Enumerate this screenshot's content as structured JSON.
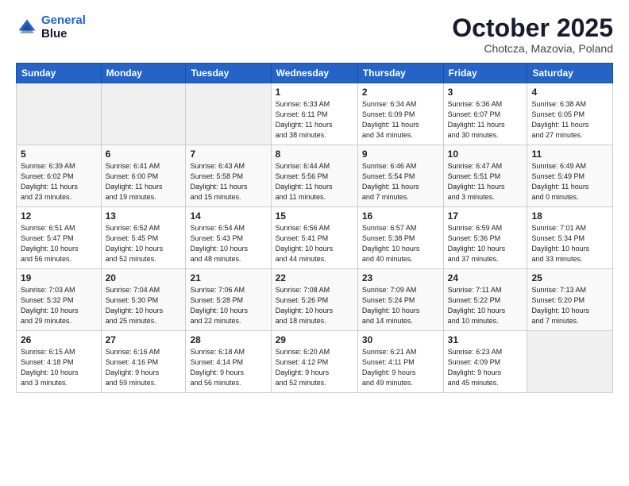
{
  "header": {
    "logo_line1": "General",
    "logo_line2": "Blue",
    "month": "October 2025",
    "location": "Chotcza, Mazovia, Poland"
  },
  "weekdays": [
    "Sunday",
    "Monday",
    "Tuesday",
    "Wednesday",
    "Thursday",
    "Friday",
    "Saturday"
  ],
  "weeks": [
    [
      {
        "day": "",
        "info": ""
      },
      {
        "day": "",
        "info": ""
      },
      {
        "day": "",
        "info": ""
      },
      {
        "day": "1",
        "info": "Sunrise: 6:33 AM\nSunset: 6:11 PM\nDaylight: 11 hours\nand 38 minutes."
      },
      {
        "day": "2",
        "info": "Sunrise: 6:34 AM\nSunset: 6:09 PM\nDaylight: 11 hours\nand 34 minutes."
      },
      {
        "day": "3",
        "info": "Sunrise: 6:36 AM\nSunset: 6:07 PM\nDaylight: 11 hours\nand 30 minutes."
      },
      {
        "day": "4",
        "info": "Sunrise: 6:38 AM\nSunset: 6:05 PM\nDaylight: 11 hours\nand 27 minutes."
      }
    ],
    [
      {
        "day": "5",
        "info": "Sunrise: 6:39 AM\nSunset: 6:02 PM\nDaylight: 11 hours\nand 23 minutes."
      },
      {
        "day": "6",
        "info": "Sunrise: 6:41 AM\nSunset: 6:00 PM\nDaylight: 11 hours\nand 19 minutes."
      },
      {
        "day": "7",
        "info": "Sunrise: 6:43 AM\nSunset: 5:58 PM\nDaylight: 11 hours\nand 15 minutes."
      },
      {
        "day": "8",
        "info": "Sunrise: 6:44 AM\nSunset: 5:56 PM\nDaylight: 11 hours\nand 11 minutes."
      },
      {
        "day": "9",
        "info": "Sunrise: 6:46 AM\nSunset: 5:54 PM\nDaylight: 11 hours\nand 7 minutes."
      },
      {
        "day": "10",
        "info": "Sunrise: 6:47 AM\nSunset: 5:51 PM\nDaylight: 11 hours\nand 3 minutes."
      },
      {
        "day": "11",
        "info": "Sunrise: 6:49 AM\nSunset: 5:49 PM\nDaylight: 11 hours\nand 0 minutes."
      }
    ],
    [
      {
        "day": "12",
        "info": "Sunrise: 6:51 AM\nSunset: 5:47 PM\nDaylight: 10 hours\nand 56 minutes."
      },
      {
        "day": "13",
        "info": "Sunrise: 6:52 AM\nSunset: 5:45 PM\nDaylight: 10 hours\nand 52 minutes."
      },
      {
        "day": "14",
        "info": "Sunrise: 6:54 AM\nSunset: 5:43 PM\nDaylight: 10 hours\nand 48 minutes."
      },
      {
        "day": "15",
        "info": "Sunrise: 6:56 AM\nSunset: 5:41 PM\nDaylight: 10 hours\nand 44 minutes."
      },
      {
        "day": "16",
        "info": "Sunrise: 6:57 AM\nSunset: 5:38 PM\nDaylight: 10 hours\nand 40 minutes."
      },
      {
        "day": "17",
        "info": "Sunrise: 6:59 AM\nSunset: 5:36 PM\nDaylight: 10 hours\nand 37 minutes."
      },
      {
        "day": "18",
        "info": "Sunrise: 7:01 AM\nSunset: 5:34 PM\nDaylight: 10 hours\nand 33 minutes."
      }
    ],
    [
      {
        "day": "19",
        "info": "Sunrise: 7:03 AM\nSunset: 5:32 PM\nDaylight: 10 hours\nand 29 minutes."
      },
      {
        "day": "20",
        "info": "Sunrise: 7:04 AM\nSunset: 5:30 PM\nDaylight: 10 hours\nand 25 minutes."
      },
      {
        "day": "21",
        "info": "Sunrise: 7:06 AM\nSunset: 5:28 PM\nDaylight: 10 hours\nand 22 minutes."
      },
      {
        "day": "22",
        "info": "Sunrise: 7:08 AM\nSunset: 5:26 PM\nDaylight: 10 hours\nand 18 minutes."
      },
      {
        "day": "23",
        "info": "Sunrise: 7:09 AM\nSunset: 5:24 PM\nDaylight: 10 hours\nand 14 minutes."
      },
      {
        "day": "24",
        "info": "Sunrise: 7:11 AM\nSunset: 5:22 PM\nDaylight: 10 hours\nand 10 minutes."
      },
      {
        "day": "25",
        "info": "Sunrise: 7:13 AM\nSunset: 5:20 PM\nDaylight: 10 hours\nand 7 minutes."
      }
    ],
    [
      {
        "day": "26",
        "info": "Sunrise: 6:15 AM\nSunset: 4:18 PM\nDaylight: 10 hours\nand 3 minutes."
      },
      {
        "day": "27",
        "info": "Sunrise: 6:16 AM\nSunset: 4:16 PM\nDaylight: 9 hours\nand 59 minutes."
      },
      {
        "day": "28",
        "info": "Sunrise: 6:18 AM\nSunset: 4:14 PM\nDaylight: 9 hours\nand 56 minutes."
      },
      {
        "day": "29",
        "info": "Sunrise: 6:20 AM\nSunset: 4:12 PM\nDaylight: 9 hours\nand 52 minutes."
      },
      {
        "day": "30",
        "info": "Sunrise: 6:21 AM\nSunset: 4:11 PM\nDaylight: 9 hours\nand 49 minutes."
      },
      {
        "day": "31",
        "info": "Sunrise: 6:23 AM\nSunset: 4:09 PM\nDaylight: 9 hours\nand 45 minutes."
      },
      {
        "day": "",
        "info": ""
      }
    ]
  ]
}
